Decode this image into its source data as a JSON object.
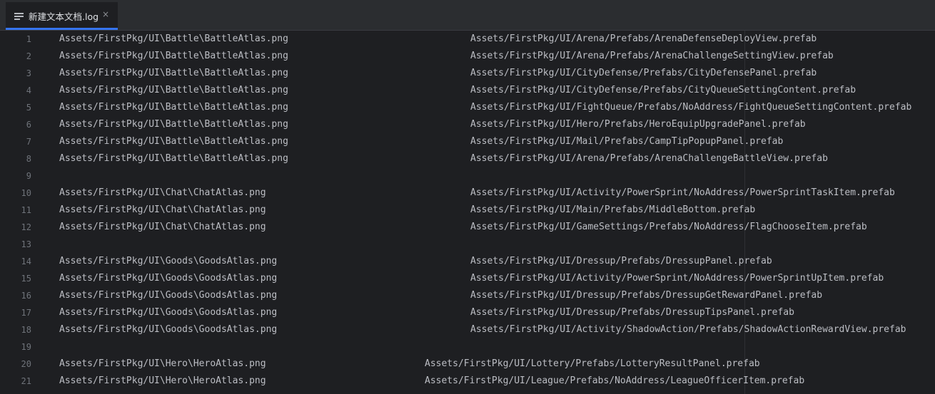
{
  "tab": {
    "title": "新建文本文档.log",
    "close": "×"
  },
  "lines": [
    {
      "n": "1",
      "a": "Assets/FirstPkg/UI\\Battle\\BattleAtlas.png",
      "b": "Assets/FirstPkg/UI/Arena/Prefabs/ArenaDefenseDeployView.prefab"
    },
    {
      "n": "2",
      "a": "Assets/FirstPkg/UI\\Battle\\BattleAtlas.png",
      "b": "Assets/FirstPkg/UI/Arena/Prefabs/ArenaChallengeSettingView.prefab"
    },
    {
      "n": "3",
      "a": "Assets/FirstPkg/UI\\Battle\\BattleAtlas.png",
      "b": "Assets/FirstPkg/UI/CityDefense/Prefabs/CityDefensePanel.prefab"
    },
    {
      "n": "4",
      "a": "Assets/FirstPkg/UI\\Battle\\BattleAtlas.png",
      "b": "Assets/FirstPkg/UI/CityDefense/Prefabs/CityQueueSettingContent.prefab"
    },
    {
      "n": "5",
      "a": "Assets/FirstPkg/UI\\Battle\\BattleAtlas.png",
      "b": "Assets/FirstPkg/UI/FightQueue/Prefabs/NoAddress/FightQueueSettingContent.prefab"
    },
    {
      "n": "6",
      "a": "Assets/FirstPkg/UI\\Battle\\BattleAtlas.png",
      "b": "Assets/FirstPkg/UI/Hero/Prefabs/HeroEquipUpgradePanel.prefab"
    },
    {
      "n": "7",
      "a": "Assets/FirstPkg/UI\\Battle\\BattleAtlas.png",
      "b": "Assets/FirstPkg/UI/Mail/Prefabs/CampTipPopupPanel.prefab"
    },
    {
      "n": "8",
      "a": "Assets/FirstPkg/UI\\Battle\\BattleAtlas.png",
      "b": "Assets/FirstPkg/UI/Arena/Prefabs/ArenaChallengeBattleView.prefab"
    },
    {
      "n": "9",
      "a": "",
      "b": ""
    },
    {
      "n": "10",
      "a": "Assets/FirstPkg/UI\\Chat\\ChatAtlas.png",
      "b": "Assets/FirstPkg/UI/Activity/PowerSprint/NoAddress/PowerSprintTaskItem.prefab"
    },
    {
      "n": "11",
      "a": "Assets/FirstPkg/UI\\Chat\\ChatAtlas.png",
      "b": "Assets/FirstPkg/UI/Main/Prefabs/MiddleBottom.prefab"
    },
    {
      "n": "12",
      "a": "Assets/FirstPkg/UI\\Chat\\ChatAtlas.png",
      "b": "Assets/FirstPkg/UI/GameSettings/Prefabs/NoAddress/FlagChooseItem.prefab"
    },
    {
      "n": "13",
      "a": "",
      "b": ""
    },
    {
      "n": "14",
      "a": "Assets/FirstPkg/UI\\Goods\\GoodsAtlas.png",
      "b": "Assets/FirstPkg/UI/Dressup/Prefabs/DressupPanel.prefab"
    },
    {
      "n": "15",
      "a": "Assets/FirstPkg/UI\\Goods\\GoodsAtlas.png",
      "b": "Assets/FirstPkg/UI/Activity/PowerSprint/NoAddress/PowerSprintUpItem.prefab"
    },
    {
      "n": "16",
      "a": "Assets/FirstPkg/UI\\Goods\\GoodsAtlas.png",
      "b": "Assets/FirstPkg/UI/Dressup/Prefabs/DressupGetRewardPanel.prefab"
    },
    {
      "n": "17",
      "a": "Assets/FirstPkg/UI\\Goods\\GoodsAtlas.png",
      "b": "Assets/FirstPkg/UI/Dressup/Prefabs/DressupTipsPanel.prefab"
    },
    {
      "n": "18",
      "a": "Assets/FirstPkg/UI\\Goods\\GoodsAtlas.png",
      "b": "Assets/FirstPkg/UI/Activity/ShadowAction/Prefabs/ShadowActionRewardView.prefab"
    },
    {
      "n": "19",
      "a": "",
      "b": ""
    },
    {
      "n": "20",
      "a": "Assets/FirstPkg/UI\\Hero\\HeroAtlas.png",
      "b": "Assets/FirstPkg/UI/Lottery/Prefabs/LotteryResultPanel.prefab"
    },
    {
      "n": "21",
      "a": "Assets/FirstPkg/UI\\Hero\\HeroAtlas.png",
      "b": "Assets/FirstPkg/UI/League/Prefabs/NoAddress/LeagueOfficerItem.prefab"
    }
  ]
}
